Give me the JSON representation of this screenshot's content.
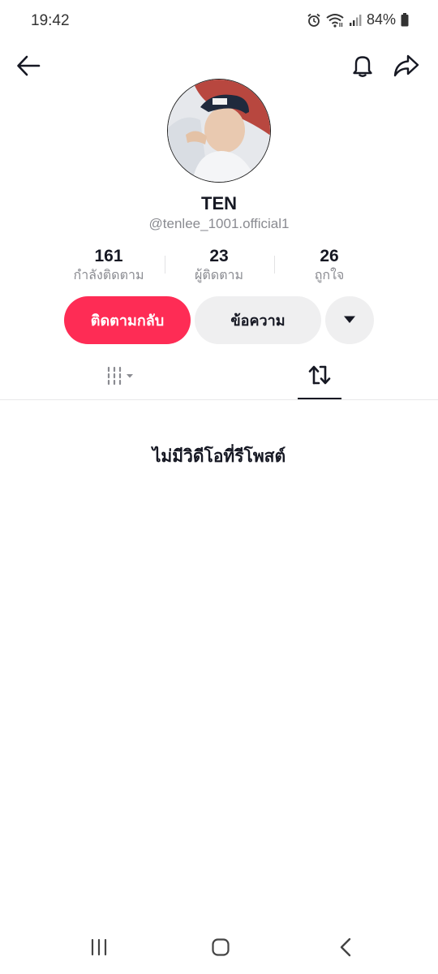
{
  "status_bar": {
    "time": "19:42",
    "battery": "84%",
    "icons": [
      "alarm-icon",
      "wifi-icon",
      "signal-icon",
      "battery-icon"
    ]
  },
  "nav": {
    "icons": [
      "back-arrow-icon",
      "bell-icon",
      "share-icon"
    ]
  },
  "profile": {
    "display_name": "TEN",
    "username": "@tenlee_1001.official1"
  },
  "stats": {
    "following_count": "161",
    "following_label": "กำลังติดตาม",
    "followers_count": "23",
    "followers_label": "ผู้ติดตาม",
    "likes_count": "26",
    "likes_label": "ถูกใจ"
  },
  "actions": {
    "follow_back_label": "ติดตามกลับ",
    "message_label": "ข้อความ",
    "more_icon": "triangle-down-icon"
  },
  "tabs": {
    "items": [
      "videos-grid-icon",
      "repost-icon"
    ],
    "active": "repost-icon"
  },
  "empty_state": {
    "text": "ไม่มีวิดีโอที่รีโพสต์"
  },
  "android_nav": {
    "icons": [
      "recent-apps-icon",
      "home-icon",
      "system-back-icon"
    ]
  },
  "colors": {
    "accent": "#fe2c55",
    "secondary_button": "#efeff0",
    "muted_text": "#8a8b91"
  }
}
